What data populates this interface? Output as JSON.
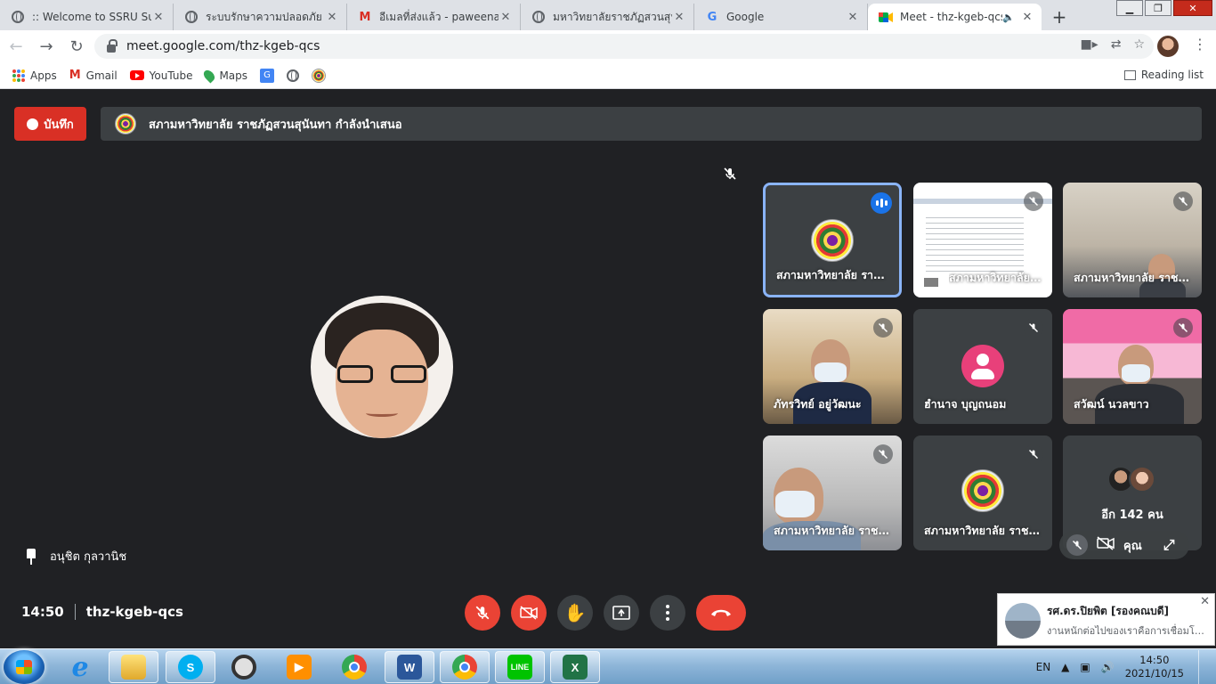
{
  "browser": {
    "tabs": [
      {
        "title": ":: Welcome to SSRU Suan",
        "icon": "globe-icon"
      },
      {
        "title": "ระบบรักษาความปลอดภัย มหา",
        "icon": "globe-icon"
      },
      {
        "title": "อีเมลที่ส่งแล้ว - paweena.sr",
        "icon": "gmail-icon"
      },
      {
        "title": "มหาวิทยาลัยราชภัฏสวนสุนันทา",
        "icon": "globe-icon"
      },
      {
        "title": "Google",
        "icon": "google-icon"
      },
      {
        "title": "Meet - thz-kgeb-qcs",
        "icon": "meet-icon",
        "active": true
      }
    ],
    "url": "meet.google.com/thz-kgeb-qcs",
    "bookmarks": [
      {
        "label": "Apps",
        "icon": "apps-grid-icon"
      },
      {
        "label": "Gmail",
        "icon": "gmail-icon"
      },
      {
        "label": "YouTube",
        "icon": "youtube-icon"
      },
      {
        "label": "Maps",
        "icon": "maps-icon"
      },
      {
        "label": "",
        "icon": "translate-icon"
      },
      {
        "label": "",
        "icon": "globe-icon"
      },
      {
        "label": "",
        "icon": "seal-icon"
      }
    ],
    "reading_list": "Reading list"
  },
  "meet": {
    "record_label": "บันทึก",
    "presenting_text": "สภามหาวิทยาลัย ราชภัฏสวนสุนันทา กำลังนำเสนอ",
    "pinned_name": "อนุชิต กุลวานิช",
    "time": "14:50",
    "meeting_code": "thz-kgeb-qcs",
    "tiles": [
      {
        "name": "สภามหาวิทยาลัย ราชภัฏสวนสุนันทา"
      },
      {
        "name": "สภามหาวิทยาลัย ราชภัฏสวนสุนันทา"
      },
      {
        "name": "สภามหาวิทยาลัย ราชภัฏสวนสุนันทา"
      },
      {
        "name": "ภัทรวิทย์ อยู่วัฒนะ"
      },
      {
        "name": "ฮำนาจ บุญถนอม"
      },
      {
        "name": "สวัฒน์ นวลขาว"
      },
      {
        "name": "สภามหาวิทยาลัย ราชภัฏสวนสุนันทา"
      },
      {
        "name": "สภามหาวิทยาลัย ราชภัฏสวนสุนันทา"
      }
    ],
    "more_people": "อีก 142 คน",
    "self_label": "คุณ"
  },
  "notification": {
    "title": "รศ.ดร.ปิยพิต [รองคณบดี]",
    "message": "งานหนักต่อไปของเราคือการเชื่อมโยงระบบ"
  },
  "taskbar": {
    "lang": "EN",
    "time": "14:50",
    "date": "2021/10/15"
  },
  "colors": {
    "meet_bg": "#202124",
    "tile_bg": "#3c4043",
    "danger_red": "#ea4335",
    "record_red": "#d93025",
    "active_border": "#8ab4f8",
    "speaking_blue": "#1a73e8"
  }
}
